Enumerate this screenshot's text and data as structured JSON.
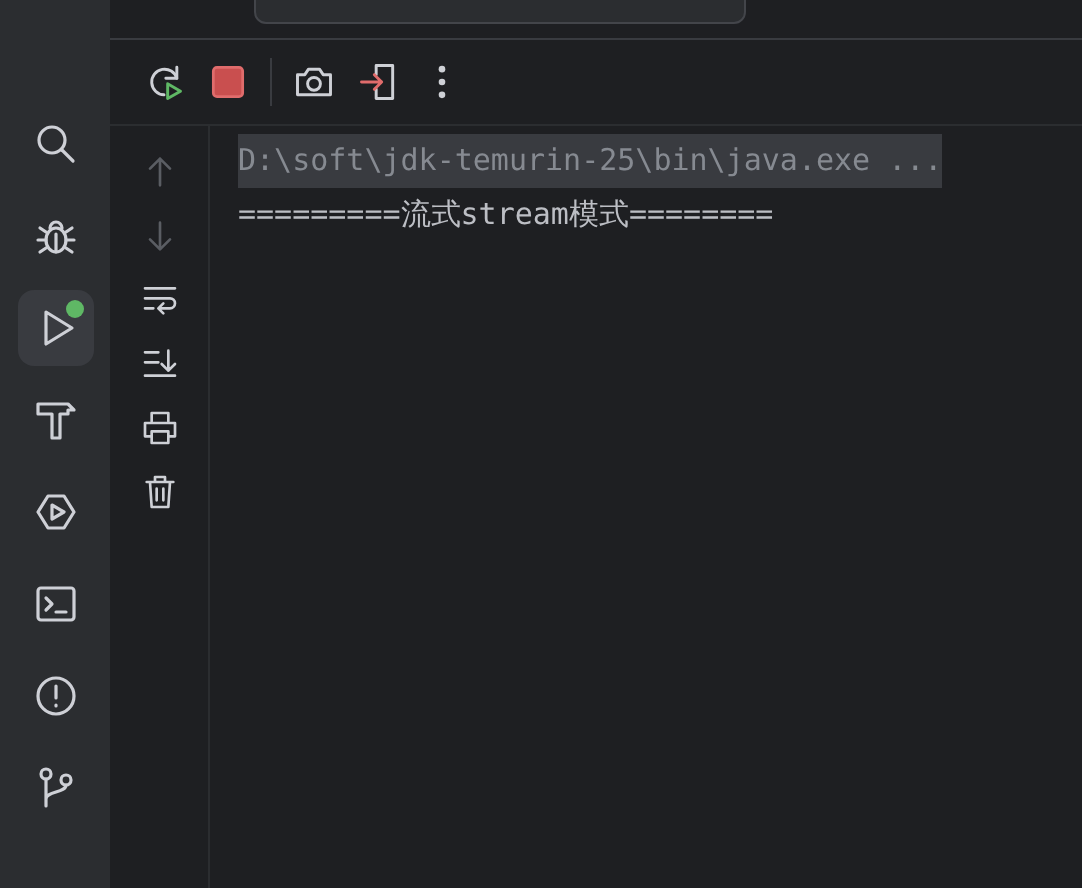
{
  "tool_window": {
    "stripe_items": [
      {
        "selected": false,
        "badge": false
      },
      {
        "selected": false,
        "badge": false
      },
      {
        "selected": true,
        "badge": true
      },
      {
        "selected": false,
        "badge": false
      },
      {
        "selected": false,
        "badge": false
      },
      {
        "selected": false,
        "badge": false
      },
      {
        "selected": false,
        "badge": false
      },
      {
        "selected": false,
        "badge": false
      }
    ],
    "side_toolbar": [
      {
        "disabled": true
      },
      {
        "disabled": true
      },
      {
        "disabled": false
      },
      {
        "disabled": false
      },
      {
        "disabled": false
      },
      {
        "disabled": false
      }
    ],
    "console": [
      {
        "text": "D:\\soft\\jdk-temurin-25\\bin\\java.exe ...",
        "kind": "command"
      },
      {
        "text": "=========流式stream模式========",
        "kind": "output"
      }
    ]
  }
}
